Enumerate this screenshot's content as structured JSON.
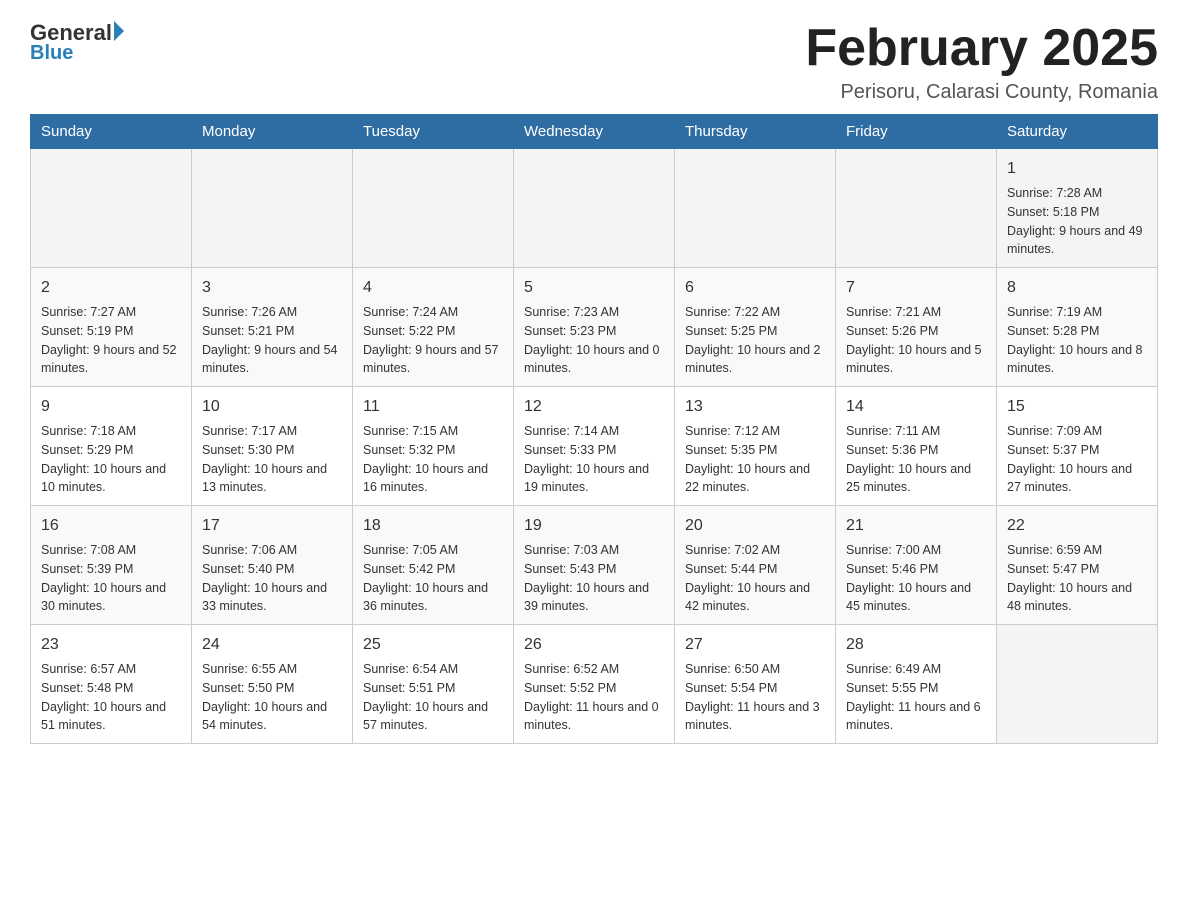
{
  "header": {
    "logo": {
      "general": "General",
      "triangle": "",
      "blue": "Blue"
    },
    "title": "February 2025",
    "location": "Perisoru, Calarasi County, Romania"
  },
  "days": [
    "Sunday",
    "Monday",
    "Tuesday",
    "Wednesday",
    "Thursday",
    "Friday",
    "Saturday"
  ],
  "weeks": [
    [
      {
        "num": "",
        "sunrise": "",
        "sunset": "",
        "daylight": ""
      },
      {
        "num": "",
        "sunrise": "",
        "sunset": "",
        "daylight": ""
      },
      {
        "num": "",
        "sunrise": "",
        "sunset": "",
        "daylight": ""
      },
      {
        "num": "",
        "sunrise": "",
        "sunset": "",
        "daylight": ""
      },
      {
        "num": "",
        "sunrise": "",
        "sunset": "",
        "daylight": ""
      },
      {
        "num": "",
        "sunrise": "",
        "sunset": "",
        "daylight": ""
      },
      {
        "num": "1",
        "sunrise": "Sunrise: 7:28 AM",
        "sunset": "Sunset: 5:18 PM",
        "daylight": "Daylight: 9 hours and 49 minutes."
      }
    ],
    [
      {
        "num": "2",
        "sunrise": "Sunrise: 7:27 AM",
        "sunset": "Sunset: 5:19 PM",
        "daylight": "Daylight: 9 hours and 52 minutes."
      },
      {
        "num": "3",
        "sunrise": "Sunrise: 7:26 AM",
        "sunset": "Sunset: 5:21 PM",
        "daylight": "Daylight: 9 hours and 54 minutes."
      },
      {
        "num": "4",
        "sunrise": "Sunrise: 7:24 AM",
        "sunset": "Sunset: 5:22 PM",
        "daylight": "Daylight: 9 hours and 57 minutes."
      },
      {
        "num": "5",
        "sunrise": "Sunrise: 7:23 AM",
        "sunset": "Sunset: 5:23 PM",
        "daylight": "Daylight: 10 hours and 0 minutes."
      },
      {
        "num": "6",
        "sunrise": "Sunrise: 7:22 AM",
        "sunset": "Sunset: 5:25 PM",
        "daylight": "Daylight: 10 hours and 2 minutes."
      },
      {
        "num": "7",
        "sunrise": "Sunrise: 7:21 AM",
        "sunset": "Sunset: 5:26 PM",
        "daylight": "Daylight: 10 hours and 5 minutes."
      },
      {
        "num": "8",
        "sunrise": "Sunrise: 7:19 AM",
        "sunset": "Sunset: 5:28 PM",
        "daylight": "Daylight: 10 hours and 8 minutes."
      }
    ],
    [
      {
        "num": "9",
        "sunrise": "Sunrise: 7:18 AM",
        "sunset": "Sunset: 5:29 PM",
        "daylight": "Daylight: 10 hours and 10 minutes."
      },
      {
        "num": "10",
        "sunrise": "Sunrise: 7:17 AM",
        "sunset": "Sunset: 5:30 PM",
        "daylight": "Daylight: 10 hours and 13 minutes."
      },
      {
        "num": "11",
        "sunrise": "Sunrise: 7:15 AM",
        "sunset": "Sunset: 5:32 PM",
        "daylight": "Daylight: 10 hours and 16 minutes."
      },
      {
        "num": "12",
        "sunrise": "Sunrise: 7:14 AM",
        "sunset": "Sunset: 5:33 PM",
        "daylight": "Daylight: 10 hours and 19 minutes."
      },
      {
        "num": "13",
        "sunrise": "Sunrise: 7:12 AM",
        "sunset": "Sunset: 5:35 PM",
        "daylight": "Daylight: 10 hours and 22 minutes."
      },
      {
        "num": "14",
        "sunrise": "Sunrise: 7:11 AM",
        "sunset": "Sunset: 5:36 PM",
        "daylight": "Daylight: 10 hours and 25 minutes."
      },
      {
        "num": "15",
        "sunrise": "Sunrise: 7:09 AM",
        "sunset": "Sunset: 5:37 PM",
        "daylight": "Daylight: 10 hours and 27 minutes."
      }
    ],
    [
      {
        "num": "16",
        "sunrise": "Sunrise: 7:08 AM",
        "sunset": "Sunset: 5:39 PM",
        "daylight": "Daylight: 10 hours and 30 minutes."
      },
      {
        "num": "17",
        "sunrise": "Sunrise: 7:06 AM",
        "sunset": "Sunset: 5:40 PM",
        "daylight": "Daylight: 10 hours and 33 minutes."
      },
      {
        "num": "18",
        "sunrise": "Sunrise: 7:05 AM",
        "sunset": "Sunset: 5:42 PM",
        "daylight": "Daylight: 10 hours and 36 minutes."
      },
      {
        "num": "19",
        "sunrise": "Sunrise: 7:03 AM",
        "sunset": "Sunset: 5:43 PM",
        "daylight": "Daylight: 10 hours and 39 minutes."
      },
      {
        "num": "20",
        "sunrise": "Sunrise: 7:02 AM",
        "sunset": "Sunset: 5:44 PM",
        "daylight": "Daylight: 10 hours and 42 minutes."
      },
      {
        "num": "21",
        "sunrise": "Sunrise: 7:00 AM",
        "sunset": "Sunset: 5:46 PM",
        "daylight": "Daylight: 10 hours and 45 minutes."
      },
      {
        "num": "22",
        "sunrise": "Sunrise: 6:59 AM",
        "sunset": "Sunset: 5:47 PM",
        "daylight": "Daylight: 10 hours and 48 minutes."
      }
    ],
    [
      {
        "num": "23",
        "sunrise": "Sunrise: 6:57 AM",
        "sunset": "Sunset: 5:48 PM",
        "daylight": "Daylight: 10 hours and 51 minutes."
      },
      {
        "num": "24",
        "sunrise": "Sunrise: 6:55 AM",
        "sunset": "Sunset: 5:50 PM",
        "daylight": "Daylight: 10 hours and 54 minutes."
      },
      {
        "num": "25",
        "sunrise": "Sunrise: 6:54 AM",
        "sunset": "Sunset: 5:51 PM",
        "daylight": "Daylight: 10 hours and 57 minutes."
      },
      {
        "num": "26",
        "sunrise": "Sunrise: 6:52 AM",
        "sunset": "Sunset: 5:52 PM",
        "daylight": "Daylight: 11 hours and 0 minutes."
      },
      {
        "num": "27",
        "sunrise": "Sunrise: 6:50 AM",
        "sunset": "Sunset: 5:54 PM",
        "daylight": "Daylight: 11 hours and 3 minutes."
      },
      {
        "num": "28",
        "sunrise": "Sunrise: 6:49 AM",
        "sunset": "Sunset: 5:55 PM",
        "daylight": "Daylight: 11 hours and 6 minutes."
      },
      {
        "num": "",
        "sunrise": "",
        "sunset": "",
        "daylight": ""
      }
    ]
  ]
}
